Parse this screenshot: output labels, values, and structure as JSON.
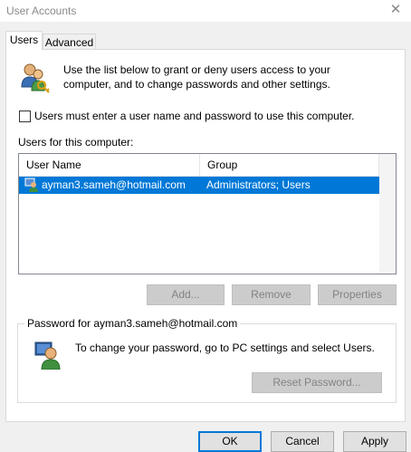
{
  "window": {
    "title": "User Accounts"
  },
  "tabs": [
    {
      "label": "Users",
      "active": true
    },
    {
      "label": "Advanced",
      "active": false
    }
  ],
  "intro": {
    "text": "Use the list below to grant or deny users access to your computer, and to change passwords and other settings.",
    "icon": "users-keys-icon"
  },
  "checkbox": {
    "label": "Users must enter a user name and password to use this computer.",
    "checked": false
  },
  "users_list": {
    "label": "Users for this computer:",
    "columns": [
      "User Name",
      "Group"
    ],
    "rows": [
      {
        "user": "ayman3.sameh@hotmail.com",
        "group": "Administrators; Users",
        "selected": true
      }
    ]
  },
  "list_buttons": {
    "add": "Add...",
    "remove": "Remove",
    "properties": "Properties"
  },
  "password": {
    "group_label": "Password for ayman3.sameh@hotmail.com",
    "text": "To change your password, go to PC settings and select Users.",
    "reset_button": "Reset Password..."
  },
  "dialog_buttons": {
    "ok": "OK",
    "cancel": "Cancel",
    "apply": "Apply"
  },
  "colors": {
    "selection": "#0078d7",
    "panel": "#ffffff",
    "chrome": "#f0f0f0"
  }
}
